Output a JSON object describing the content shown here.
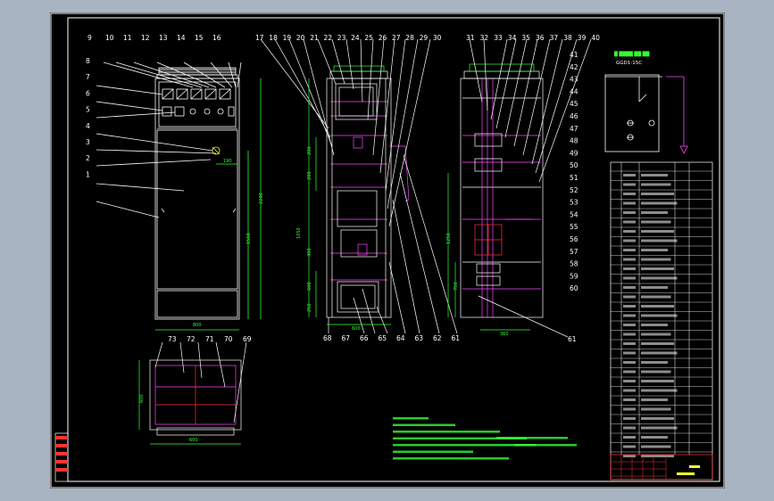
{
  "drawing": {
    "title_code": "GGD1-15C",
    "front_labels": [
      "9",
      "10",
      "11",
      "12",
      "13",
      "14",
      "15",
      "16"
    ],
    "front_left_labels": [
      "8",
      "7",
      "6",
      "5",
      "4",
      "3",
      "2",
      "1"
    ],
    "side_labels": [
      "17",
      "18",
      "19",
      "20",
      "21",
      "22",
      "23",
      "24",
      "25",
      "26",
      "27",
      "28",
      "29",
      "30"
    ],
    "back_labels": [
      "31",
      "32",
      "33",
      "34",
      "35",
      "36",
      "37",
      "38",
      "39",
      "40"
    ],
    "right_labels": [
      "41",
      "42",
      "43",
      "44",
      "45",
      "46",
      "47",
      "48",
      "49",
      "50",
      "51",
      "52",
      "53",
      "54",
      "55",
      "56",
      "57",
      "58",
      "59",
      "60"
    ],
    "bottom_mid_labels": [
      "68",
      "67",
      "66",
      "65",
      "64",
      "63",
      "62",
      "61"
    ],
    "plan_labels": [
      "73",
      "72",
      "71",
      "70",
      "69"
    ],
    "front_width_dim": "800",
    "plan_width_dim": "600",
    "back_width_dim": "360",
    "side_width_dim": "600",
    "plan_depth_dim": "600",
    "front_dims": [
      "2200",
      "1560",
      "190"
    ],
    "side_dims": [
      "200",
      "200",
      "1050",
      "300",
      "600",
      "250"
    ],
    "back_dims": [
      "1250",
      "750"
    ]
  },
  "colors": {
    "background": "#a9b4c2",
    "sheet": "#000000",
    "line": "#ffffff",
    "dim": "#33ff33",
    "accent": "#ff44ff",
    "red": "#ff3333",
    "yellow": "#ffff33"
  }
}
